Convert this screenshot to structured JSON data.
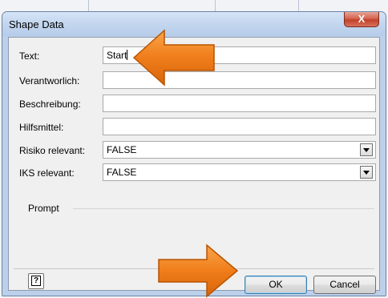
{
  "dialog": {
    "title": "Shape Data",
    "close_label": "X"
  },
  "fields": [
    {
      "label": "Text:",
      "value": "Start",
      "type": "text"
    },
    {
      "label": "Verantworlich:",
      "value": "",
      "type": "text"
    },
    {
      "label": "Beschreibung:",
      "value": "",
      "type": "text"
    },
    {
      "label": "Hilfsmittel:",
      "value": "",
      "type": "text"
    },
    {
      "label": "Risiko relevant:",
      "value": "FALSE",
      "type": "select"
    },
    {
      "label": "IKS relevant:",
      "value": "FALSE",
      "type": "select"
    }
  ],
  "prompt": {
    "label": "Prompt"
  },
  "buttons": {
    "help_label": "?",
    "ok_label": "OK",
    "cancel_label": "Cancel"
  },
  "annotations": {
    "arrow_color": "#f07d1a",
    "arrow_outline": "#c25600"
  },
  "icons": [
    "close-icon",
    "help-icon",
    "dropdown-arrow-icon"
  ]
}
